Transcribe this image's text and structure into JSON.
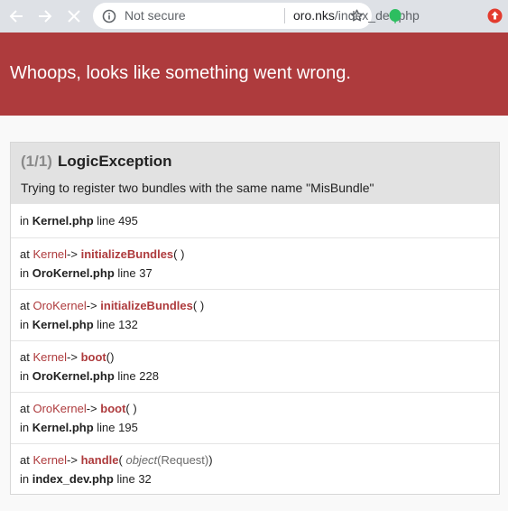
{
  "browser": {
    "security_label": "Not secure",
    "url_host": "oro.nks",
    "url_path": "/index_dev.php",
    "icons": {
      "back": "back-arrow-icon",
      "forward": "forward-arrow-icon",
      "stop": "close-icon",
      "info": "info-icon",
      "bookmark": "star-icon",
      "extension": "evernote-extension-icon",
      "update": "update-icon"
    }
  },
  "error": {
    "title": "Whoops, looks like something went wrong.",
    "count": "(1/1)",
    "exception_class": "LogicException",
    "message": "Trying to register two bundles with the same name \"MisBundle\""
  },
  "trace": [
    {
      "file": "Kernel.php",
      "line": "495"
    },
    {
      "class": "Kernel",
      "function": "initializeBundles",
      "args_open": "(",
      "args_close": ")",
      "file": "OroKernel.php",
      "line": "37"
    },
    {
      "class": "OroKernel",
      "function": "initializeBundles",
      "args_open": "(",
      "args_close": ")",
      "file": "Kernel.php",
      "line": "132"
    },
    {
      "class": "Kernel",
      "function": "boot",
      "args_open": "(",
      "args_close": ")",
      "file": "OroKernel.php",
      "line": "228"
    },
    {
      "class": "OroKernel",
      "function": "boot",
      "args_open": "(",
      "args_close": ")",
      "file": "Kernel.php",
      "line": "195"
    },
    {
      "class": "Kernel",
      "function": "handle",
      "args_open": "(",
      "arg_type": "object",
      "arg_value": "(Request)",
      "args_close": ")",
      "file": "index_dev.php",
      "line": "32"
    }
  ],
  "labels": {
    "at": "at",
    "in": "in",
    "arrow": "->",
    "line": "line"
  },
  "colors": {
    "header_bg": "#ae3b3d",
    "accent": "#ae3b3d"
  }
}
